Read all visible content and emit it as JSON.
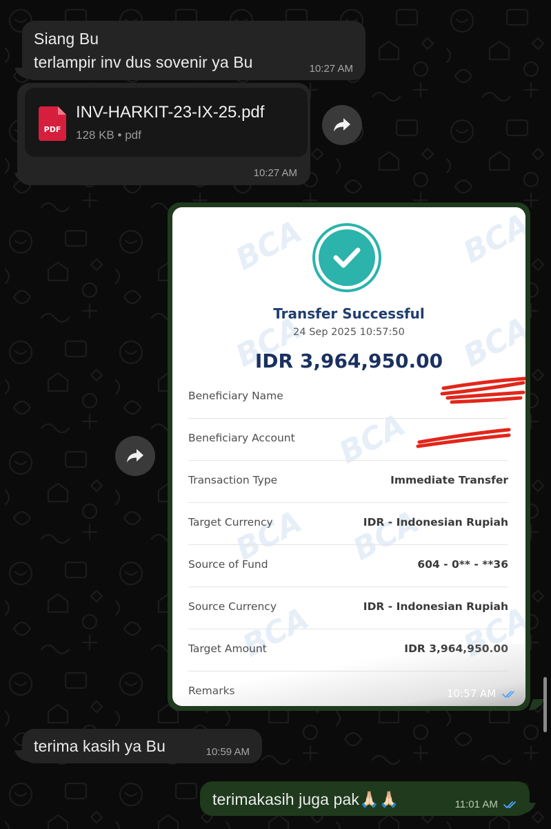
{
  "messages": [
    {
      "direction": "incoming",
      "lines": [
        "Siang Bu",
        "terlampir inv dus sovenir ya Bu"
      ],
      "time": "10:27 AM"
    },
    {
      "direction": "incoming",
      "attachment": {
        "file_name": "INV-HARKIT-23-IX-25.pdf",
        "file_size": "128 KB",
        "file_type": "pdf",
        "icon_label": "PDF"
      },
      "time": "10:27 AM"
    },
    {
      "direction": "outgoing",
      "receipt": {
        "watermark": "BCA",
        "status_title": "Transfer Successful",
        "datetime": "24 Sep 2025 10:57:50",
        "amount": "IDR 3,964,950.00",
        "rows": [
          {
            "label": "Beneficiary Name",
            "value": ""
          },
          {
            "label": "Beneficiary Account",
            "value": ""
          },
          {
            "label": "Transaction Type",
            "value": "Immediate Transfer"
          },
          {
            "label": "Target Currency",
            "value": "IDR - Indonesian Rupiah"
          },
          {
            "label": "Source of Fund",
            "value": "604 - 0** - **36"
          },
          {
            "label": "Source Currency",
            "value": "IDR - Indonesian Rupiah"
          },
          {
            "label": "Target Amount",
            "value": "IDR 3,964,950.00"
          },
          {
            "label": "Remarks",
            "value": ""
          }
        ]
      },
      "time": "10:57 AM",
      "status": "read"
    },
    {
      "direction": "incoming",
      "lines": [
        "terima kasih ya Bu"
      ],
      "time": "10:59 AM"
    },
    {
      "direction": "outgoing",
      "lines": [
        "terimakasih juga pak🙏🏻🙏🏻"
      ],
      "time": "11:01 AM",
      "status": "read"
    }
  ],
  "colors": {
    "incoming_bubble": "#242424",
    "outgoing_bubble": "#1f3a1d",
    "read_tick": "#4fa3ff",
    "success_teal": "#2bb3ac",
    "bca_navy": "#1a3160",
    "pdf_red": "#d61f3c"
  },
  "icons": [
    "forward-icon",
    "pdf-icon",
    "checkmark-icon",
    "double-check-icon"
  ]
}
